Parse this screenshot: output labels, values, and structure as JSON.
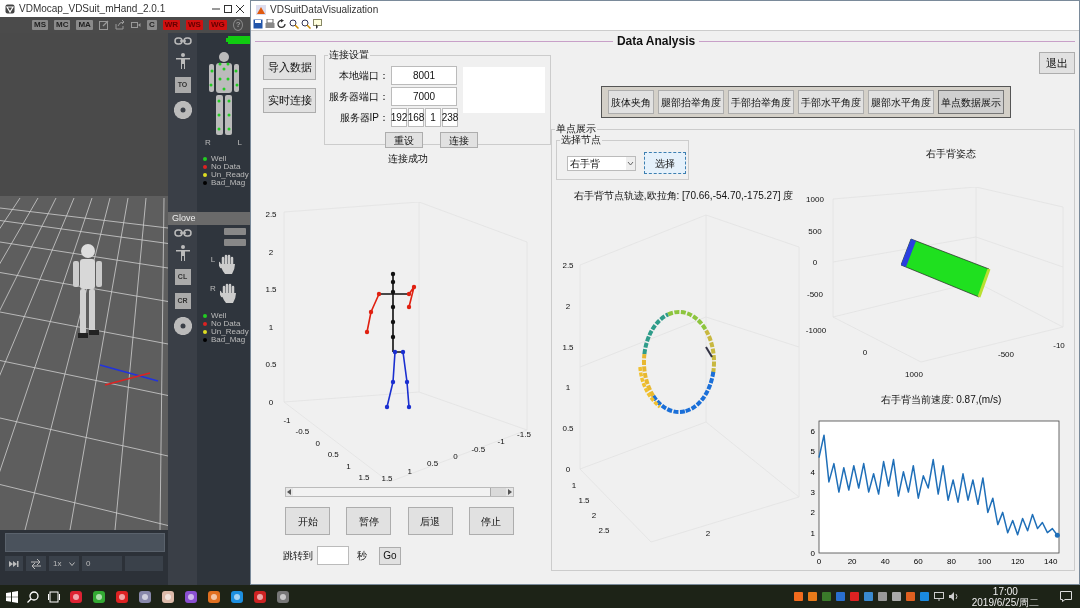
{
  "mocap_window": {
    "title": "VDMocap_VDSuit_mHand_2.0.1",
    "toolbar": [
      {
        "kind": "key",
        "label": "MS"
      },
      {
        "kind": "key",
        "label": "MC"
      },
      {
        "kind": "key",
        "label": "MA"
      },
      {
        "kind": "edit"
      },
      {
        "kind": "share"
      },
      {
        "kind": "camera"
      },
      {
        "kind": "key",
        "label": "C"
      },
      {
        "kind": "alert",
        "label": "WR"
      },
      {
        "kind": "alert",
        "label": "WS"
      },
      {
        "kind": "alert",
        "label": "WG"
      },
      {
        "kind": "help",
        "label": "?"
      }
    ],
    "suit_panel": {
      "button": "TO",
      "side_labels": [
        "R",
        "L"
      ],
      "legend": [
        {
          "label": "Well",
          "color": "#22cc22"
        },
        {
          "label": "No Data",
          "color": "#dd2222"
        },
        {
          "label": "Un_Ready",
          "color": "#dddd22"
        },
        {
          "label": "Bad_Mag",
          "color": "#000000"
        }
      ]
    },
    "glove_panel": {
      "title": "Glove",
      "buttons": [
        "CL",
        "CR"
      ],
      "hands": [
        "L",
        "R"
      ],
      "legend": [
        {
          "label": "Well",
          "color": "#22cc22"
        },
        {
          "label": "No Data",
          "color": "#dd2222"
        },
        {
          "label": "Un_Ready",
          "color": "#dddd22"
        },
        {
          "label": "Bad_Mag",
          "color": "#000000"
        }
      ]
    },
    "playback": {
      "speed": "1x",
      "frame": "0"
    }
  },
  "analysis_window": {
    "title": "VDSuitDataVisualization",
    "heading": "Data Analysis",
    "side_buttons": [
      "导入数据",
      "实时连接"
    ],
    "exit_button": "退出",
    "connection": {
      "legend": "连接设置",
      "fields": [
        {
          "label": "本地端口：",
          "value": "8001"
        },
        {
          "label": "服务器端口：",
          "value": "7000"
        }
      ],
      "ip": {
        "label": "服务器IP：",
        "parts": [
          "192",
          "168",
          "1",
          "238"
        ]
      },
      "buttons": [
        "重设",
        "连接"
      ]
    },
    "status": "连接成功",
    "skeleton_plot": {
      "z_ticks": [
        "2.5",
        "2",
        "1.5",
        "1",
        "0.5",
        "0"
      ],
      "x_ticks": [
        "-1",
        "-0.5",
        "0",
        "0.5",
        "1",
        "1.5"
      ],
      "y_ticks": [
        "-1.5",
        "-1",
        "-0.5",
        "0",
        "0.5",
        "1",
        "1.5"
      ]
    },
    "timeline": {
      "level": 0.93
    },
    "playback_buttons": [
      "开始",
      "暂停",
      "后退",
      "停止"
    ],
    "jump": {
      "label": "跳转到",
      "unit": "秒",
      "button": "Go"
    },
    "views": [
      {
        "label": "肢体夹角",
        "selected": false
      },
      {
        "label": "腿部抬举角度",
        "selected": false
      },
      {
        "label": "手部抬举角度",
        "selected": false
      },
      {
        "label": "手部水平角度",
        "selected": false
      },
      {
        "label": "腿部水平角度",
        "selected": false
      },
      {
        "label": "单点数据展示",
        "selected": true
      }
    ],
    "single_point": {
      "legend": "单点展示",
      "node_group": {
        "legend": "选择节点",
        "value": "右手背",
        "button": "选择"
      },
      "trajectory": {
        "title": "右手背节点轨迹,欧拉角: [70.66,-54.70,-175.27] 度",
        "z_ticks": [
          "2.5",
          "2",
          "1.5",
          "1",
          "0.5",
          "0"
        ],
        "x_ticks": [
          "1",
          "1.5",
          "2",
          "2.5"
        ],
        "y_ticks": [
          "2"
        ]
      },
      "pose": {
        "title": "右手背姿态",
        "z_ticks": [
          "1000",
          "500",
          "0",
          "-500"
        ],
        "x_ticks": [
          "-1000",
          "0",
          "1000"
        ],
        "y_ticks": [
          "-500",
          "-10"
        ]
      },
      "speed": {
        "title": "右手背当前速度: 0.87,(m/s)",
        "chart_data": {
          "type": "line",
          "xlim": [
            0,
            145
          ],
          "ylim": [
            0,
            6.5
          ],
          "xticks": [
            0,
            20,
            40,
            60,
            80,
            100,
            120,
            140
          ],
          "yticks": [
            0,
            1,
            2,
            3,
            4,
            5,
            6
          ],
          "x": [
            0,
            3,
            6,
            9,
            12,
            15,
            18,
            21,
            24,
            27,
            30,
            33,
            36,
            39,
            42,
            45,
            48,
            51,
            54,
            57,
            60,
            63,
            66,
            69,
            72,
            75,
            78,
            81,
            84,
            87,
            90,
            93,
            96,
            99,
            102,
            105,
            108,
            111,
            114,
            117,
            120,
            123,
            126,
            129,
            132,
            135,
            138,
            141,
            144
          ],
          "series": [
            {
              "color": "#1f6fb8",
              "values": [
                4.7,
                5.8,
                3.5,
                4.4,
                3.0,
                4.2,
                3.1,
                4.3,
                3.2,
                4.4,
                3.0,
                3.9,
                2.9,
                4.5,
                3.3,
                4.6,
                2.8,
                4.0,
                3.0,
                4.3,
                2.7,
                3.8,
                3.2,
                4.6,
                2.9,
                4.3,
                2.6,
                3.6,
                2.5,
                3.9,
                2.6,
                3.6,
                2.4,
                3.7,
                2.0,
                2.7,
                1.4,
                2.0,
                1.0,
                1.6,
                0.9,
                1.7,
                1.1,
                1.9,
                1.2,
                1.5,
                1.0,
                1.2,
                0.87
              ]
            }
          ]
        }
      }
    }
  },
  "taskbar": {
    "time": "17:00",
    "date": "2019/6/25/周二"
  }
}
